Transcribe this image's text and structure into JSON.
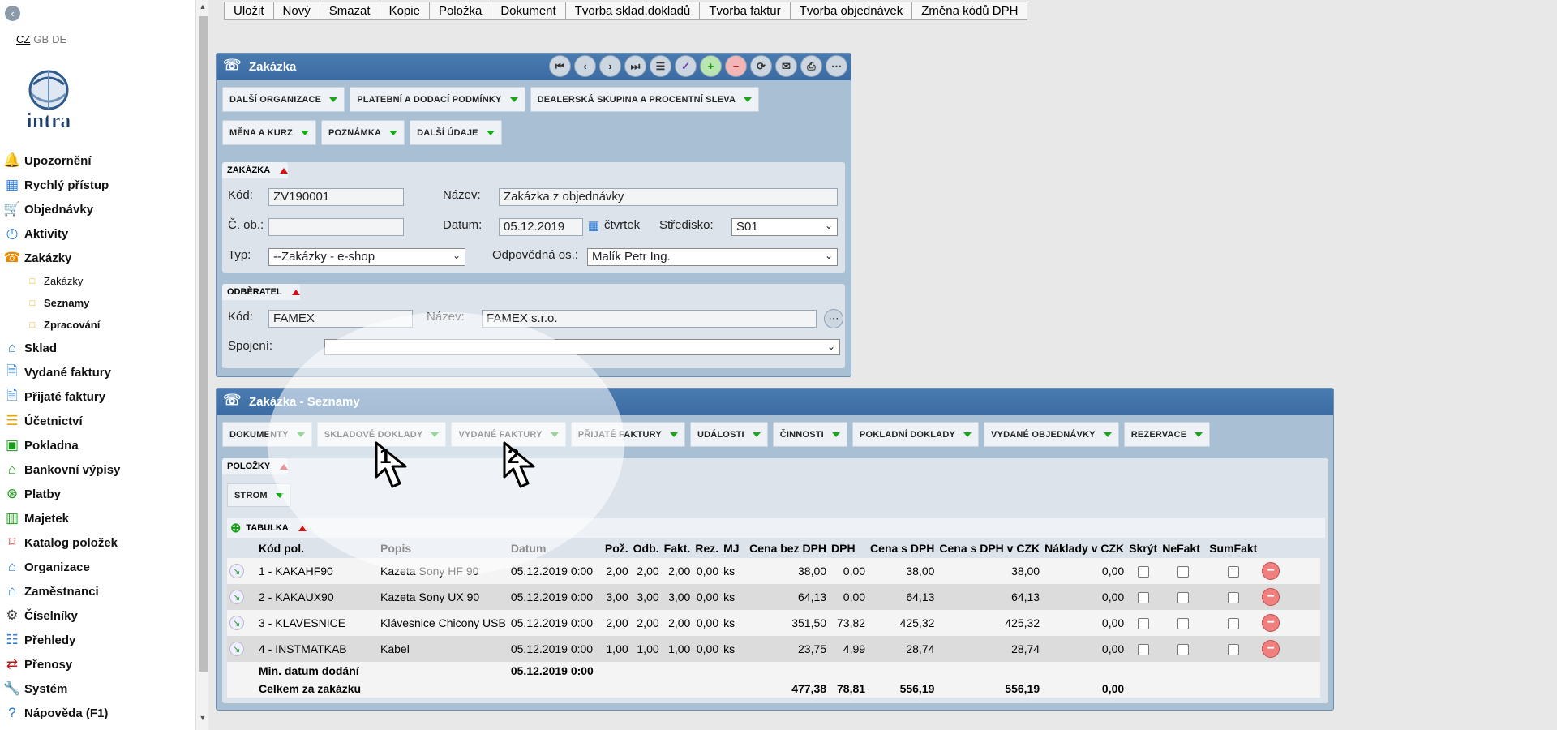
{
  "languages": [
    "CZ",
    "GB",
    "DE"
  ],
  "logo_text": "intra",
  "menu": [
    {
      "label": "Upozornění",
      "icon": "bell-icon",
      "glyph": "🔔",
      "color": "#e8a700"
    },
    {
      "label": "Rychlý přístup",
      "icon": "quick-access-icon",
      "glyph": "▦",
      "color": "#2a7bd8"
    },
    {
      "label": "Objednávky",
      "icon": "cart-icon",
      "glyph": "🛒",
      "color": "#169c16"
    },
    {
      "label": "Aktivity",
      "icon": "clock-icon",
      "glyph": "◴",
      "color": "#2a7bd8"
    },
    {
      "label": "Zakázky",
      "icon": "phone-icon",
      "glyph": "☎",
      "color": "#e88a00"
    },
    {
      "label": "Zakázky",
      "icon": "folder-icon",
      "glyph": "□",
      "sub": true,
      "thin": true
    },
    {
      "label": "Seznamy",
      "icon": "folder-icon",
      "glyph": "□",
      "sub": true
    },
    {
      "label": "Zpracování",
      "icon": "folder-icon",
      "glyph": "□",
      "sub": true
    },
    {
      "label": "Sklad",
      "icon": "warehouse-icon",
      "glyph": "⌂",
      "color": "#2a7bd8"
    },
    {
      "label": "Vydané faktury",
      "icon": "invoice-out-icon",
      "glyph": "🗎",
      "color": "#2a7bd8"
    },
    {
      "label": "Přijaté faktury",
      "icon": "invoice-in-icon",
      "glyph": "🗎",
      "color": "#2a7bd8"
    },
    {
      "label": "Účetnictví",
      "icon": "ledger-icon",
      "glyph": "☰",
      "color": "#e8a700"
    },
    {
      "label": "Pokladna",
      "icon": "cashbox-icon",
      "glyph": "▣",
      "color": "#169c16"
    },
    {
      "label": "Bankovní výpisy",
      "icon": "bank-icon",
      "glyph": "⌂",
      "color": "#169c16"
    },
    {
      "label": "Platby",
      "icon": "payment-icon",
      "glyph": "⊛",
      "color": "#169c16"
    },
    {
      "label": "Majetek",
      "icon": "property-icon",
      "glyph": "▥",
      "color": "#169c16"
    },
    {
      "label": "Katalog položek",
      "icon": "tag-icon",
      "glyph": "⌑",
      "color": "#c05050"
    },
    {
      "label": "Organizace",
      "icon": "organization-icon",
      "glyph": "⌂",
      "color": "#2a7bd8"
    },
    {
      "label": "Zaměstnanci",
      "icon": "employees-icon",
      "glyph": "⌂",
      "color": "#2a7bd8"
    },
    {
      "label": "Číselníky",
      "icon": "gear-icon",
      "glyph": "⚙",
      "color": "#444"
    },
    {
      "label": "Přehledy",
      "icon": "report-icon",
      "glyph": "☷",
      "color": "#2a7bd8"
    },
    {
      "label": "Přenosy",
      "icon": "transfer-icon",
      "glyph": "⇄",
      "color": "#c01818"
    },
    {
      "label": "Systém",
      "icon": "wrench-icon",
      "glyph": "🔧",
      "color": "#555"
    },
    {
      "label": "Nápověda (F1)",
      "icon": "help-icon",
      "glyph": "?",
      "color": "#2a7bd8"
    }
  ],
  "toolbar": [
    "Uložit",
    "Nový",
    "Smazat",
    "Kopie",
    "Položka",
    "Dokument",
    "Tvorba sklad.dokladů",
    "Tvorba faktur",
    "Tvorba objednávek",
    "Změna kódů DPH"
  ],
  "zakazka": {
    "title": "Zakázka",
    "tabs": [
      "DALŠÍ ORGANIZACE",
      "PLATEBNÍ A DODACÍ PODMÍNKY",
      "DEALERSKÁ SKUPINA A PROCENTNÍ SLEVA",
      "MĚNA A KURZ",
      "POZNÁMKA",
      "DALŠÍ ÚDAJE"
    ],
    "section_title": "ZAKÁZKA",
    "kod_label": "Kód:",
    "kod_value": "ZV190001",
    "nazev_label": "Název:",
    "nazev_value": "Zakázka z objednávky",
    "cob_label": "Č. ob.:",
    "cob_value": "",
    "datum_label": "Datum:",
    "datum_value": "05.12.2019",
    "den": "čtvrtek",
    "stredisko_label": "Středisko:",
    "stredisko_value": "S01",
    "typ_label": "Typ:",
    "typ_value": "--Zakázky - e-shop",
    "odpovedna_label": "Odpovědná os.:",
    "odpovedna_value": "Malík Petr Ing.",
    "odberatel_title": "ODBĚRATEL",
    "odb_kod_label": "Kód:",
    "odb_kod_value": "FAMEX",
    "odb_nazev_label": "Název:",
    "odb_nazev_value": "FAMEX s.r.o.",
    "spojeni_label": "Spojení:",
    "spojeni_value": ""
  },
  "seznamy": {
    "title": "Zakázka - Seznamy",
    "tabs": [
      "DOKUMENTY",
      "SKLADOVÉ DOKLADY",
      "VYDANÉ FAKTURY",
      "PŘIJATÉ FAKTURY",
      "UDÁLOSTI",
      "ČINNOSTI",
      "POKLADNÍ DOKLADY",
      "VYDANÉ OBJEDNÁVKY",
      "REZERVACE"
    ],
    "polozky_title": "POLOŽKY",
    "strom_label": "STROM",
    "tabulka_label": "TABULKA",
    "columns": [
      "Kód pol.",
      "Popis",
      "Datum",
      "Pož.",
      "Odb.",
      "Fakt.",
      "Rez.",
      "MJ",
      "Cena bez DPH",
      "DPH",
      "Cena s DPH",
      "Cena s DPH v CZK",
      "Náklady v CZK",
      "Skrýt",
      "NeFakt",
      "SumFakt"
    ],
    "rows": [
      [
        "1 - KAKAHF90",
        "Kazeta Sony HF 90",
        "05.12.2019 0:00",
        "2,00",
        "2,00",
        "2,00",
        "0,00",
        "ks",
        "38,00",
        "0,00",
        "38,00",
        "38,00",
        "0,00"
      ],
      [
        "2 - KAKAUX90",
        "Kazeta Sony UX 90",
        "05.12.2019 0:00",
        "3,00",
        "3,00",
        "3,00",
        "0,00",
        "ks",
        "64,13",
        "0,00",
        "64,13",
        "64,13",
        "0,00"
      ],
      [
        "3 - KLAVESNICE",
        "Klávesnice Chicony USB",
        "05.12.2019 0:00",
        "2,00",
        "2,00",
        "2,00",
        "0,00",
        "ks",
        "351,50",
        "73,82",
        "425,32",
        "425,32",
        "0,00"
      ],
      [
        "4 - INSTMATKAB",
        "Kabel",
        "05.12.2019 0:00",
        "1,00",
        "1,00",
        "1,00",
        "0,00",
        "ks",
        "23,75",
        "4,99",
        "28,74",
        "28,74",
        "0,00"
      ]
    ],
    "min_datum_label": "Min. datum dodání",
    "min_datum_value": "05.12.2019 0:00",
    "celkem_label": "Celkem za zakázku",
    "celkem": {
      "cena_bez": "477,38",
      "dph": "78,81",
      "cena_s": "556,19",
      "cena_czk": "556,19",
      "naklady": "0,00"
    }
  },
  "cursor_numbers": [
    "1",
    "2"
  ]
}
